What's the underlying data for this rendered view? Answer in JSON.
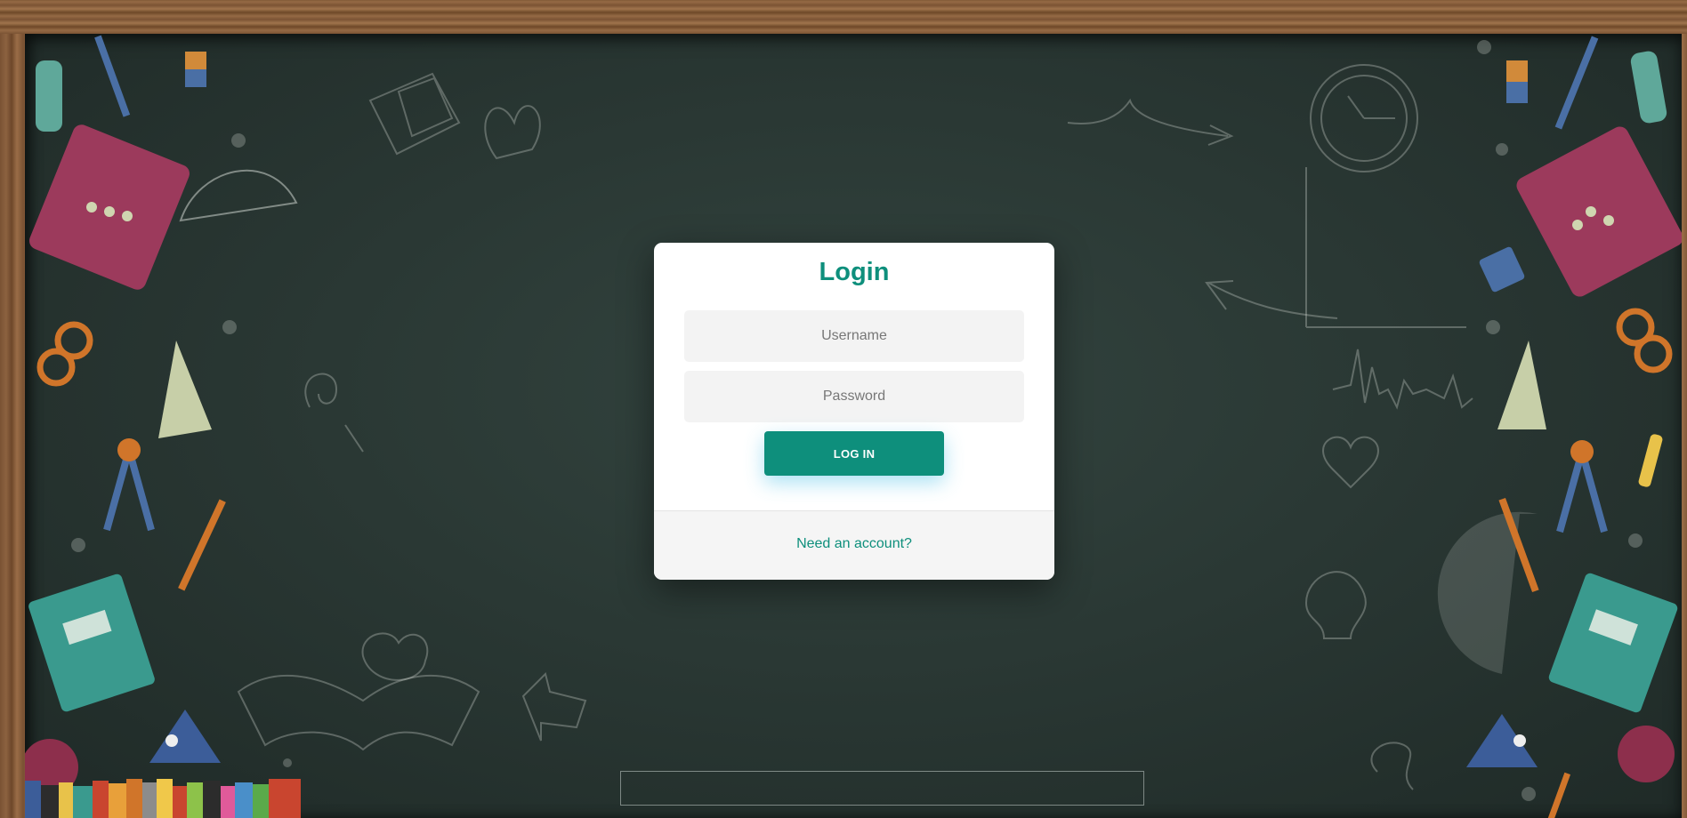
{
  "login": {
    "title": "Login",
    "username_placeholder": "Username",
    "password_placeholder": "Password",
    "button_label": "LOG IN",
    "signup_link": "Need an account?"
  },
  "colors": {
    "accent": "#0e8f7c",
    "card_bg": "#ffffff",
    "field_bg": "#f3f3f3",
    "footer_bg": "#f5f5f5",
    "chalkboard": "#2a3834",
    "frame_wood": "#7a5233"
  },
  "decorations": [
    "glue-bottle-icon",
    "pencil-icon",
    "eraser-icon",
    "calculator-icon",
    "desk-lamp-icon",
    "pencil-cup-icon",
    "scissors-icon",
    "set-square-icon",
    "compass-icon",
    "notebook-icon",
    "flask-icon",
    "apple-icon",
    "books-row-icon",
    "open-book-icon",
    "alarm-clock-icon",
    "arrow-doodle",
    "heart-doodle",
    "lightbulb-doodle",
    "graph-doodle",
    "protractor-icon"
  ]
}
